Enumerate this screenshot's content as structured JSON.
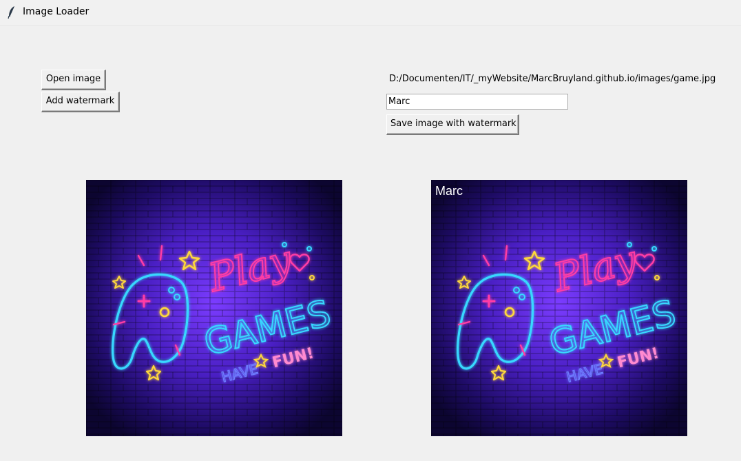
{
  "window": {
    "title": "Image Loader",
    "icon": "feather-icon"
  },
  "controls": {
    "open_label": "Open image",
    "watermark_label": "Add watermark",
    "save_label": "Save image with watermark"
  },
  "file": {
    "path": "D:/Documenten/IT/_myWebsite/MarcBruyland.github.io/images/game.jpg"
  },
  "watermark": {
    "input_value": "Marc",
    "overlay_text": "Marc"
  },
  "artwork": {
    "title_line1": "Play",
    "title_line2": "GAMES",
    "tagline_left": "HAVE",
    "tagline_right": "FUN!"
  },
  "colors": {
    "window_bg": "#f0f0f0",
    "neon_cyan": "#38d8ff",
    "neon_pink": "#ff3ea5",
    "neon_yellow": "#ffd93b"
  }
}
